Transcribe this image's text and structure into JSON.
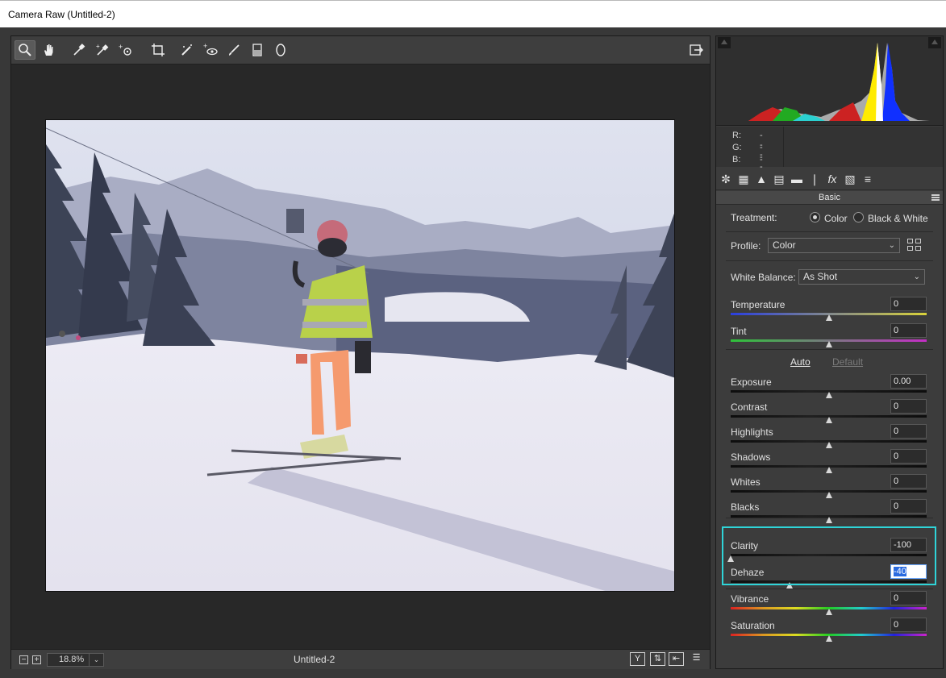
{
  "window": {
    "title": "Camera Raw (Untitled-2)"
  },
  "toolbar": {
    "tools": [
      {
        "name": "zoom-tool",
        "icon": "magnifier-icon"
      },
      {
        "name": "hand-tool",
        "icon": "hand-icon"
      },
      {
        "name": "white-balance-tool",
        "icon": "eyedropper-icon"
      },
      {
        "name": "color-sampler-tool",
        "icon": "color-sampler-icon"
      },
      {
        "name": "targeted-adjustment-tool",
        "icon": "target-adjust-icon"
      },
      {
        "name": "crop-tool",
        "icon": "crop-icon"
      },
      {
        "name": "spot-removal-tool",
        "icon": "spot-removal-icon"
      },
      {
        "name": "red-eye-tool",
        "icon": "red-eye-icon"
      },
      {
        "name": "adjustment-brush-tool",
        "icon": "brush-icon"
      },
      {
        "name": "graduated-filter-tool",
        "icon": "graduated-filter-icon"
      },
      {
        "name": "radial-filter-tool",
        "icon": "radial-filter-icon"
      }
    ],
    "open_prefs_icon": "export-icon"
  },
  "status": {
    "zoom": "18.8%",
    "doc_name": "Untitled-2",
    "zoom_out": "−",
    "zoom_in": "+",
    "y_label": "Y"
  },
  "readout": {
    "r_label": "R:",
    "g_label": "G:",
    "b_label": "B:",
    "r": "---",
    "g": "---",
    "b": "---"
  },
  "panel": {
    "title": "Basic",
    "treatment_label": "Treatment:",
    "treatment_color": "Color",
    "treatment_bw": "Black & White",
    "treatment_selected": "Color",
    "profile_label": "Profile:",
    "profile_value": "Color",
    "wb_label": "White Balance:",
    "wb_value": "As Shot",
    "auto": "Auto",
    "default": "Default"
  },
  "sliders": [
    {
      "label": "Temperature",
      "value": "0",
      "level": 0.5,
      "track": "temp"
    },
    {
      "label": "Tint",
      "value": "0",
      "level": 0.5,
      "track": "tint"
    },
    {
      "label": "Exposure",
      "value": "0.00",
      "level": 0.5,
      "track": "dark"
    },
    {
      "label": "Contrast",
      "value": "0",
      "level": 0.5,
      "track": "dark"
    },
    {
      "label": "Highlights",
      "value": "0",
      "level": 0.5,
      "track": "dark"
    },
    {
      "label": "Shadows",
      "value": "0",
      "level": 0.5,
      "track": "dark"
    },
    {
      "label": "Whites",
      "value": "0",
      "level": 0.5,
      "track": "dark"
    },
    {
      "label": "Blacks",
      "value": "0",
      "level": 0.5,
      "track": "dark"
    },
    {
      "label": "Clarity",
      "value": "-100",
      "level": 0.0,
      "track": "dark"
    },
    {
      "label": "Dehaze",
      "value": "-40",
      "level": 0.3,
      "track": "dark"
    },
    {
      "label": "Vibrance",
      "value": "0",
      "level": 0.5,
      "track": "rainbow"
    },
    {
      "label": "Saturation",
      "value": "0",
      "level": 0.5,
      "track": "rainbow"
    }
  ],
  "colors": {
    "highlight": "#2fd4d8",
    "panel_bg": "#3c3c3c"
  }
}
